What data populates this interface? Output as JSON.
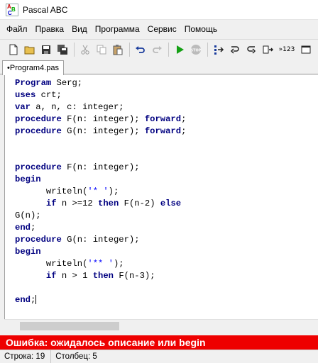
{
  "window": {
    "title": "Pascal ABC"
  },
  "menu": [
    "Файл",
    "Правка",
    "Вид",
    "Программа",
    "Сервис",
    "Помощь"
  ],
  "toolbar": {
    "label_123": "»123"
  },
  "tabs": [
    {
      "label": "•Program4.pas"
    }
  ],
  "editor": {
    "lines": [
      [
        {
          "t": "Program",
          "c": "kw"
        },
        {
          "t": " Serg;",
          "c": "n"
        }
      ],
      [
        {
          "t": "uses",
          "c": "kw"
        },
        {
          "t": " crt;",
          "c": "n"
        }
      ],
      [
        {
          "t": "var",
          "c": "kw"
        },
        {
          "t": " a, n, c: integer;",
          "c": "n"
        }
      ],
      [
        {
          "t": "procedure",
          "c": "kw"
        },
        {
          "t": " F(n: integer); ",
          "c": "n"
        },
        {
          "t": "forward",
          "c": "kw"
        },
        {
          "t": ";",
          "c": "n"
        }
      ],
      [
        {
          "t": "procedure",
          "c": "kw"
        },
        {
          "t": " G(n: integer); ",
          "c": "n"
        },
        {
          "t": "forward",
          "c": "kw"
        },
        {
          "t": ";",
          "c": "n"
        }
      ],
      [],
      [],
      [
        {
          "t": "procedure",
          "c": "kw"
        },
        {
          "t": " F(n: integer);",
          "c": "n"
        }
      ],
      [
        {
          "t": "begin",
          "c": "kw"
        }
      ],
      [
        {
          "t": "      writeln(",
          "c": "n"
        },
        {
          "t": "'* '",
          "c": "str"
        },
        {
          "t": ");",
          "c": "n"
        }
      ],
      [
        {
          "t": "      ",
          "c": "n"
        },
        {
          "t": "if",
          "c": "kw"
        },
        {
          "t": " n >=12 ",
          "c": "n"
        },
        {
          "t": "then",
          "c": "kw"
        },
        {
          "t": " F(n-2) ",
          "c": "n"
        },
        {
          "t": "else",
          "c": "kw"
        }
      ],
      [
        {
          "t": "G(n);",
          "c": "n"
        }
      ],
      [
        {
          "t": "end",
          "c": "kw"
        },
        {
          "t": ";",
          "c": "n"
        }
      ],
      [
        {
          "t": "procedure",
          "c": "kw"
        },
        {
          "t": " G(n: integer);",
          "c": "n"
        }
      ],
      [
        {
          "t": "begin",
          "c": "kw"
        }
      ],
      [
        {
          "t": "      writeln(",
          "c": "n"
        },
        {
          "t": "'** '",
          "c": "str"
        },
        {
          "t": ");",
          "c": "n"
        }
      ],
      [
        {
          "t": "      ",
          "c": "n"
        },
        {
          "t": "if",
          "c": "kw"
        },
        {
          "t": " n > 1 ",
          "c": "n"
        },
        {
          "t": "then",
          "c": "kw"
        },
        {
          "t": " F(n-3);",
          "c": "n"
        }
      ],
      [],
      [
        {
          "t": "end",
          "c": "kw"
        },
        {
          "t": ";",
          "c": "n"
        },
        {
          "t": "|CARET|",
          "c": "caret"
        }
      ]
    ]
  },
  "error": {
    "message": "Ошибка: ожидалось описание или begin"
  },
  "status": {
    "row": "Строка: 19",
    "col": "Столбец: 5"
  },
  "colors": {
    "error_bg": "#ee0000",
    "keyword": "#000080",
    "string": "#0000ff"
  }
}
